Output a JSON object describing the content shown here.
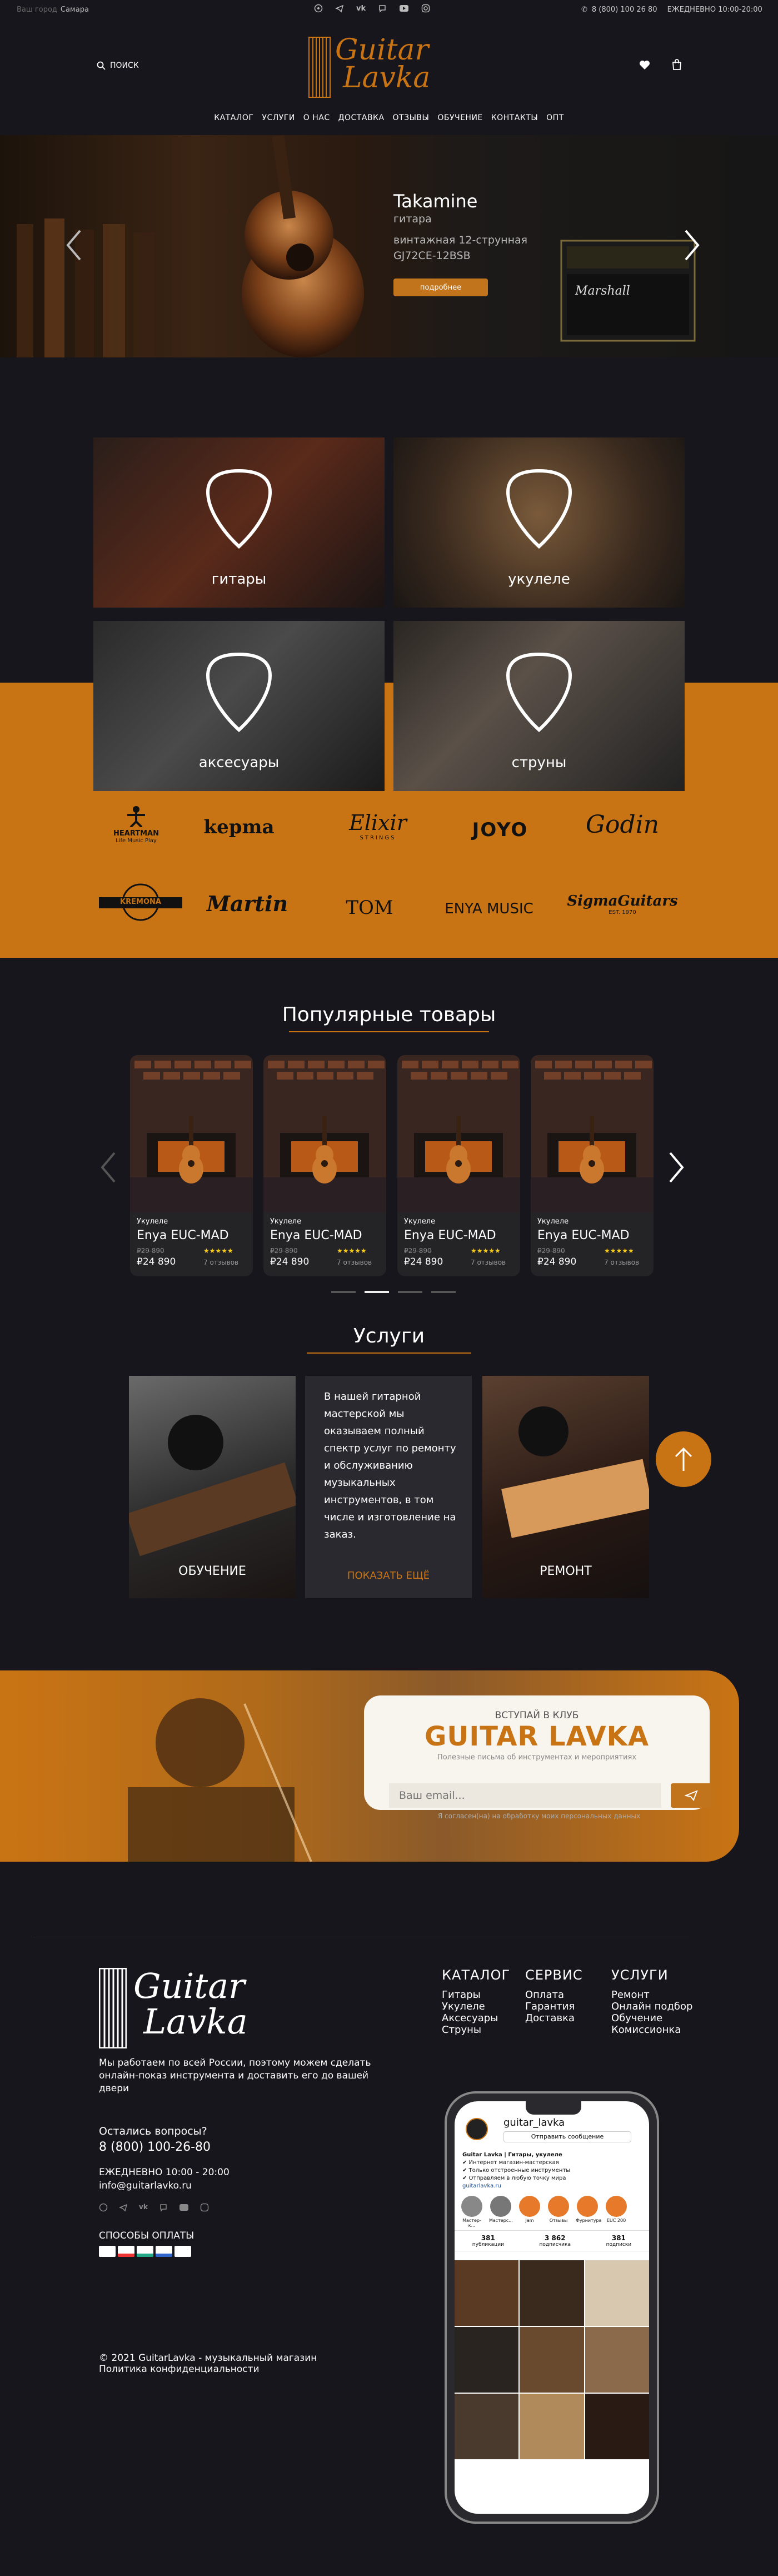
{
  "topbar": {
    "city_prompt": "Ваш город",
    "city": "Самара",
    "phone": "8 (800) 100 26 80",
    "hours": "ЕЖЕДНЕВНО 10:00-20:00"
  },
  "header": {
    "search_label": "ПОИСК",
    "logo_line1": "Guitar",
    "logo_line2": "Lavka"
  },
  "nav": [
    "КАТАЛОГ",
    "УСЛУГИ",
    "О НАС",
    "ДОСТАВКА",
    "ОТЗЫВЫ",
    "ОБУЧЕНИЕ",
    "КОНТАКТЫ",
    "ОПТ"
  ],
  "hero": {
    "brand": "Takamine",
    "type": "гитара",
    "desc1": "винтажная 12-струнная",
    "model": "GJ72CE-12BSB",
    "cta": "подробнее",
    "amp_brand": "Marshall"
  },
  "categories": [
    {
      "label": "гитары"
    },
    {
      "label": "укулеле"
    },
    {
      "label": "аксесуары"
    },
    {
      "label": "струны"
    }
  ],
  "brands": [
    "HEARTMAN",
    "kepma",
    "Elixir",
    "STRINGS",
    "JOYO",
    "Godin",
    "KREMONA",
    "Martin",
    "TOM",
    "ENYA MUSIC",
    "SigmaGuitars",
    "EST. 1970",
    "Life Music Play"
  ],
  "popular": {
    "title": "Популярные товары",
    "items": [
      {
        "category": "Укулеле",
        "name": "Enya EUC-MAD",
        "old_price": "₽29 890",
        "price": "₽24 890",
        "reviews": "7 отзывов",
        "stars": "★★★★★"
      },
      {
        "category": "Укулеле",
        "name": "Enya EUC-MAD",
        "old_price": "₽29 890",
        "price": "₽24 890",
        "reviews": "7 отзывов",
        "stars": "★★★★★"
      },
      {
        "category": "Укулеле",
        "name": "Enya EUC-MAD",
        "old_price": "₽29 890",
        "price": "₽24 890",
        "reviews": "7 отзывов",
        "stars": "★★★★★"
      },
      {
        "category": "Укулеле",
        "name": "Enya EUC-MAD",
        "old_price": "₽29 890",
        "price": "₽24 890",
        "reviews": "7 отзывов",
        "stars": "★★★★★"
      }
    ]
  },
  "services": {
    "title": "Услуги",
    "learning": "ОБУЧЕНИЕ",
    "text": "В нашей гитарной мастерской мы оказываем полный спектр услуг по ремонту и обслуживанию музыкальных инструментов, в том числе и изготовление на заказ.",
    "more": "ПОКАЗАТЬ ЕЩЁ",
    "repair": "РЕМОНТ"
  },
  "club": {
    "join": "ВСТУПАЙ В КЛУБ",
    "name": "GUITAR LAVKA",
    "sub": "Полезные письма об инструментах и мероприятиях",
    "placeholder": "Ваш email...",
    "consent": "Я согласен(на) на обработку моих персональных данных"
  },
  "footer": {
    "about": "Мы работаем по всей России, поэтому можем сделать онлайн-показ инструмента и доставить его до вашей двери",
    "questions": "Остались вопросы?",
    "phone": "8 (800) 100-26-80",
    "hours": "ЕЖЕДНЕВНО 10:00 - 20:00",
    "email": "info@guitarlavko.ru",
    "payments_label": "СПОСОБЫ ОПЛАТЫ",
    "copyright": "© 2021 GuitarLavka - музыкальный магазин",
    "privacy": "Политика конфиденциальности",
    "col1_title": "КАТАЛОГ",
    "col1": [
      "Гитары",
      "Укулеле",
      "Аксесуары",
      "Струны"
    ],
    "col2_title": "СЕРВИС",
    "col2": [
      "Оплата",
      "Гарантия",
      "Доставка"
    ],
    "col3_title": "УСЛУГИ",
    "col3": [
      "Ремонт",
      "Онлайн подбор",
      "Обучение",
      "Комиссионка"
    ]
  },
  "phone_mock": {
    "handle": "guitar_lavka",
    "send": "Отправить сообщение",
    "bio_name": "Guitar Lavka | Гитары, укулеле",
    "bio1": "✔ Интернет магазин-мастерская",
    "bio2": "✔ Только отстроенные инструменты",
    "bio3": "✔ Отправляем в любую точку мира",
    "site": "guitarlavka.ru",
    "posts": "381",
    "posts_label": "публикации",
    "followers": "3 862",
    "followers_label": "подписчика",
    "following": "381",
    "following_label": "подписки",
    "highlights": [
      "Мастер-к...",
      "Мастерс...",
      "Jam",
      "Отзывы",
      "Фурнитура",
      "EUC 200"
    ]
  },
  "colors": {
    "accent": "#c97414",
    "bg": "#17161d"
  }
}
